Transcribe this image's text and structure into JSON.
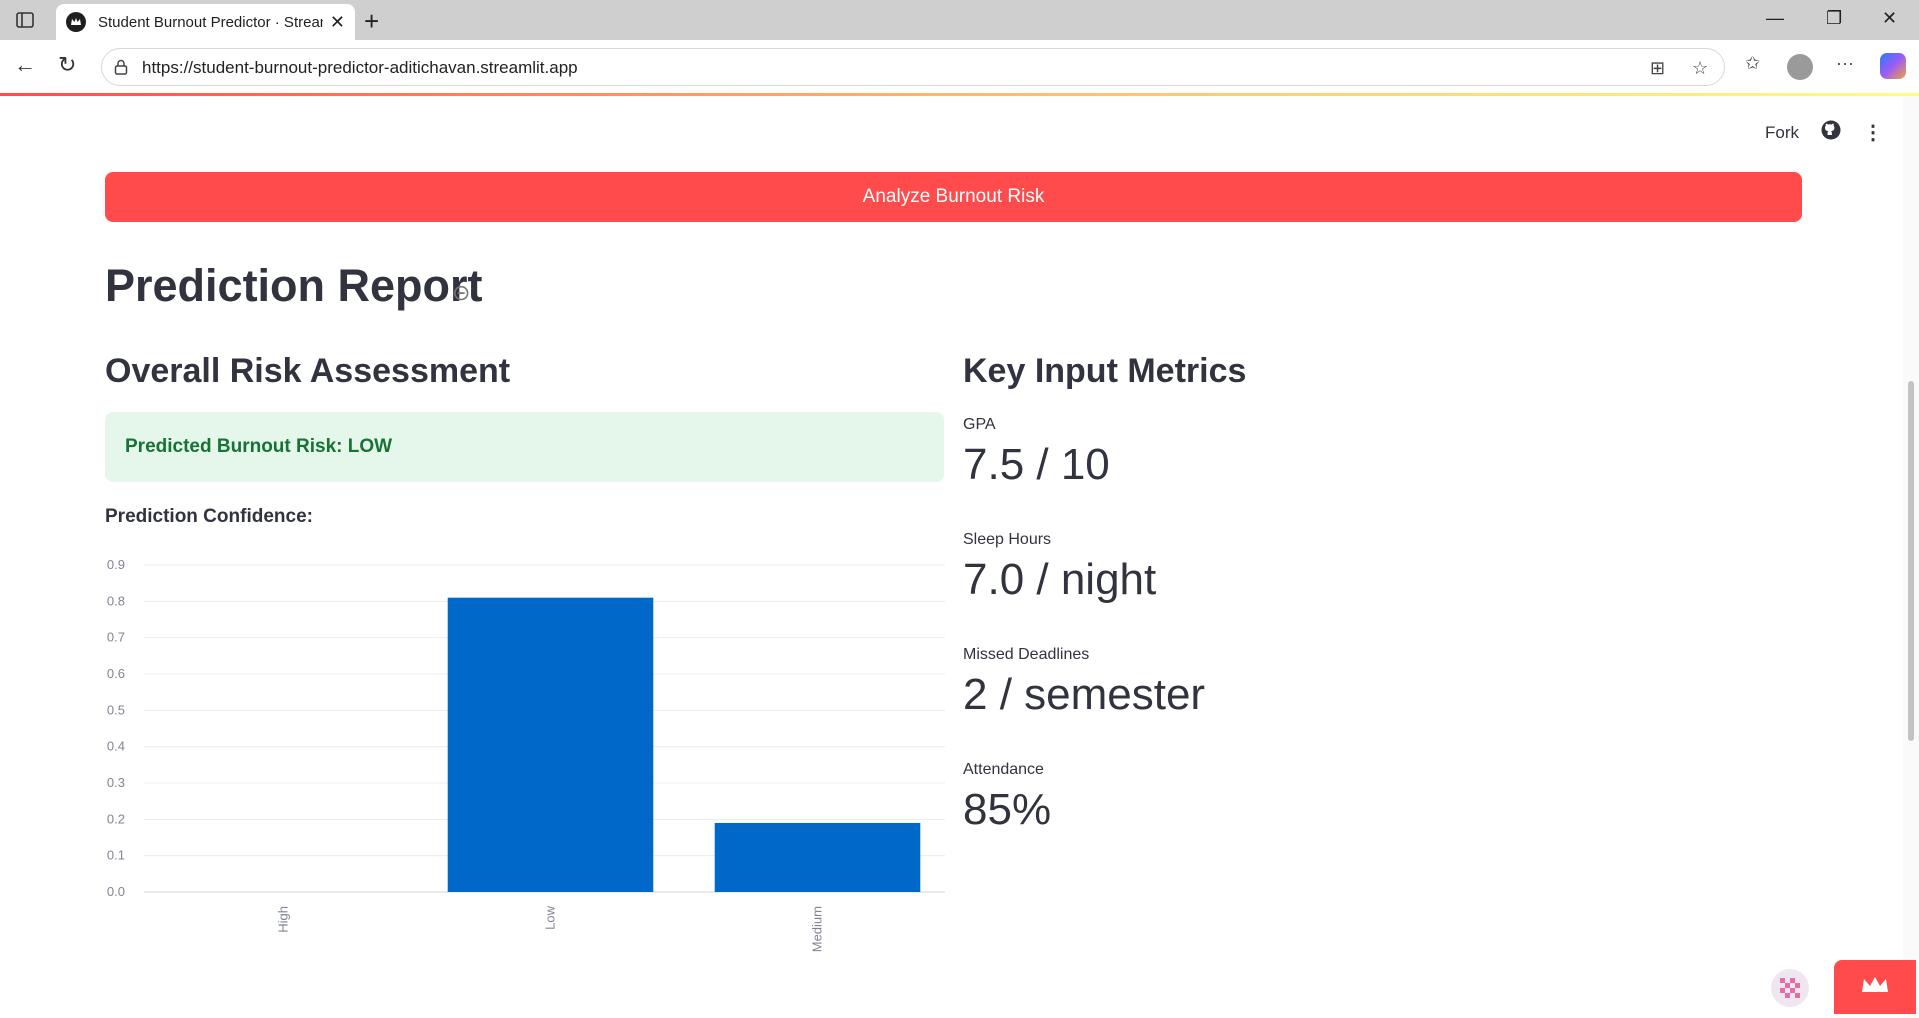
{
  "browser": {
    "tab_title": "Student Burnout Predictor · Streamlit",
    "url": "https://student-burnout-predictor-aditichavan.streamlit.app",
    "icons": [
      "sidebar-toggle-icon",
      "back-arrow-icon",
      "reload-icon",
      "lock-icon",
      "apps-icon",
      "star-icon",
      "favorites-icon",
      "profile-icon",
      "more-icon",
      "copilot-icon"
    ]
  },
  "app": {
    "header": {
      "fork_label": "Fork"
    },
    "analyze_button": "Analyze Burnout Risk",
    "report_title": "Prediction Report",
    "left": {
      "title": "Overall Risk Assessment",
      "result": "Predicted Burnout Risk: LOW",
      "confidence_label": "Prediction Confidence:"
    },
    "right": {
      "title": "Key Input Metrics",
      "metrics": [
        {
          "label": "GPA",
          "value": "7.5 / 10"
        },
        {
          "label": "Sleep Hours",
          "value": "7.0 / night"
        },
        {
          "label": "Missed Deadlines",
          "value": "2 / semester"
        },
        {
          "label": "Attendance",
          "value": "85%"
        }
      ]
    }
  },
  "colors": {
    "primary": "#ff4b4b",
    "bar": "#0068c9",
    "success_bg": "#e5f6ea",
    "success_text": "#177233"
  },
  "chart_data": {
    "type": "bar",
    "categories": [
      "High",
      "Low",
      "Medium"
    ],
    "values": [
      0.0,
      0.81,
      0.19
    ],
    "y_ticks": [
      "0.0",
      "0.1",
      "0.2",
      "0.3",
      "0.4",
      "0.5",
      "0.6",
      "0.7",
      "0.8",
      "0.9"
    ],
    "ylim": [
      0,
      0.9
    ],
    "grid": true,
    "title": "",
    "xlabel": "",
    "ylabel": ""
  }
}
